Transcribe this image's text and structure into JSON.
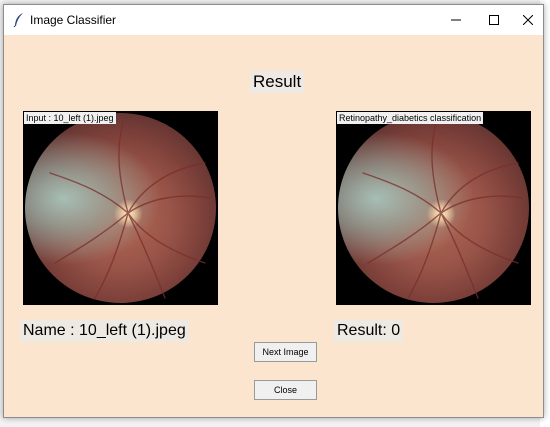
{
  "window": {
    "title": "Image Classifier",
    "icons": {
      "app": "feather-icon",
      "minimize": "minimize-icon",
      "maximize": "maximize-icon",
      "close": "close-icon"
    }
  },
  "main": {
    "heading": "Result",
    "input_panel": {
      "label": "Input : 10_left (1).jpeg"
    },
    "output_panel": {
      "label": "Retinopathy_diabetics classification"
    },
    "name_text": "Name : 10_left (1).jpeg",
    "result_text": "Result: 0"
  },
  "buttons": {
    "next_label": "Next Image",
    "close_label": "Close"
  },
  "colors": {
    "window_bg": "#fce5cf",
    "titlebar_bg": "#ffffff",
    "button_bg": "#f0f0f0"
  }
}
